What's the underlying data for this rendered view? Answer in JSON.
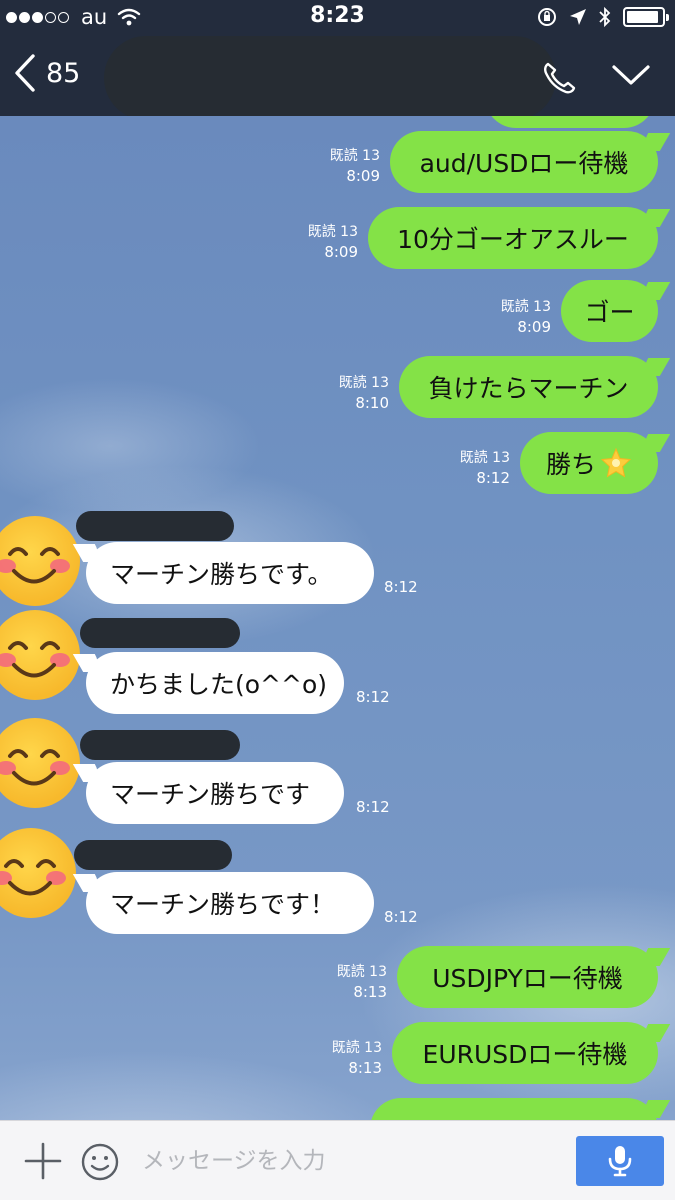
{
  "status_bar": {
    "carrier": "au",
    "time": "8:23",
    "battery_level": 0.9
  },
  "header": {
    "unread_count": "85"
  },
  "messages": [
    {
      "id": "m1",
      "direction": "out",
      "text": "aud/USDロー待機",
      "read": "既読 13",
      "time": "8:09"
    },
    {
      "id": "m2",
      "direction": "out",
      "text": "10分ゴーオアスルー",
      "read": "既読 13",
      "time": "8:09"
    },
    {
      "id": "m3",
      "direction": "out",
      "text": "ゴー",
      "read": "既読 13",
      "time": "8:09"
    },
    {
      "id": "m4",
      "direction": "out",
      "text": "負けたらマーチン",
      "read": "既読 13",
      "time": "8:10"
    },
    {
      "id": "m5",
      "direction": "out",
      "text": "勝ち",
      "emoji": "star-emoji",
      "read": "既読 13",
      "time": "8:12"
    },
    {
      "id": "m6",
      "direction": "in",
      "text": "マーチン勝ちです。",
      "time": "8:12"
    },
    {
      "id": "m7",
      "direction": "in",
      "text": "かちました(o^^o)",
      "time": "8:12"
    },
    {
      "id": "m8",
      "direction": "in",
      "text": "マーチン勝ちです",
      "time": "8:12"
    },
    {
      "id": "m9",
      "direction": "in",
      "text": "マーチン勝ちです！",
      "time": "8:12"
    },
    {
      "id": "m10",
      "direction": "out",
      "text": "USDJPYロー待機",
      "read": "既読 13",
      "time": "8:13"
    },
    {
      "id": "m11",
      "direction": "out",
      "text": "EURUSDロー待機",
      "read": "既読 13",
      "time": "8:13"
    }
  ],
  "input": {
    "placeholder": "メッセージを入力",
    "value": ""
  },
  "icons": {
    "back": "chevron-left-icon",
    "call": "phone-icon",
    "menu": "chevron-down-icon",
    "plus": "plus-icon",
    "emoji": "smiley-icon",
    "mic": "microphone-icon"
  },
  "colors": {
    "header_bg": "#232c3d",
    "outgoing_bubble": "#84e247",
    "incoming_bubble": "#ffffff",
    "mic_button": "#4a87e8"
  }
}
